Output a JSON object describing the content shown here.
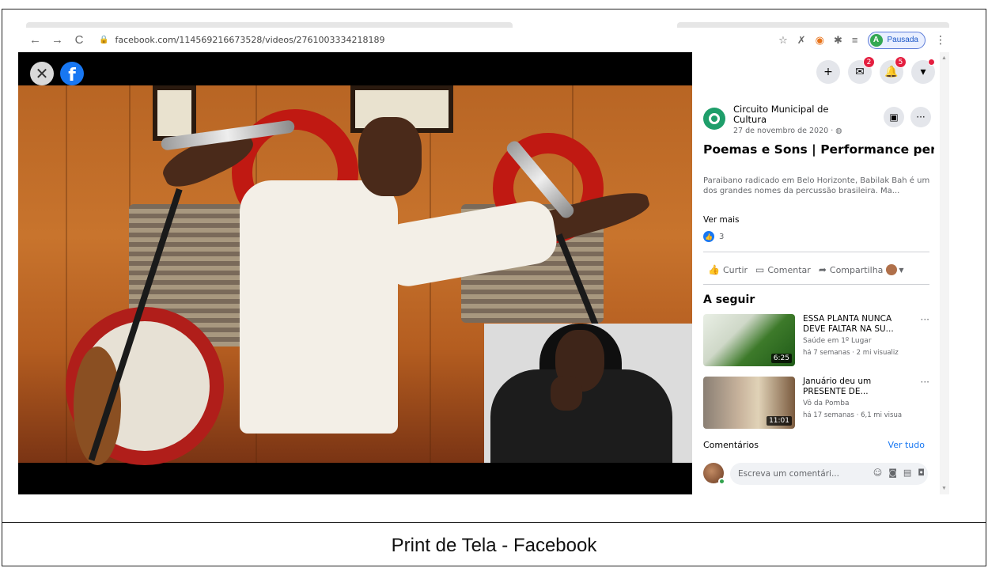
{
  "document": {
    "caption": "Print de Tela - Facebook"
  },
  "browser": {
    "url": "facebook.com/114569216673528/videos/2761003334218189",
    "profile_status": "Pausada",
    "profile_initial": "A"
  },
  "video": {
    "close_glyph": "✕",
    "fb_glyph": "f"
  },
  "topbar": {
    "messenger_badge": "2",
    "notifications_badge": "5"
  },
  "post": {
    "page_name": "Circuito Municipal de Cultura",
    "date": "27 de novembro de 2020 · ",
    "title": "Poemas e Sons | Performance percussiva de Babilak Bah (com...",
    "description": "Paraibano radicado em Belo Horizonte, Babilak Bah é um dos grandes nomes da percussão brasileira. Ma...",
    "see_more": "Ver mais",
    "reaction_count": "3",
    "actions": {
      "like": "Curtir",
      "comment": "Comentar",
      "share": "Compartilha"
    }
  },
  "up_next": {
    "heading": "A seguir",
    "items": [
      {
        "title": "ESSA PLANTA NUNCA DEVE FALTAR NA SU...",
        "channel": "Saúde em 1º Lugar",
        "meta": "há 7 semanas · 2 mi visualiz",
        "duration": "6:25"
      },
      {
        "title": "Januário deu um PRESENTE DE...",
        "channel": "Vô da Pomba",
        "meta": "há 17 semanas · 6,1 mi visua",
        "duration": "11:01"
      }
    ]
  },
  "comments": {
    "heading": "Comentários",
    "see_all": "Ver tudo",
    "placeholder": "Escreva um comentári..."
  },
  "icons": {
    "back": "back-arrow-icon",
    "forward": "forward-arrow-icon",
    "reload": "reload-icon",
    "lock": "lock-icon",
    "star": "star-icon",
    "extension": "puzzle-icon",
    "plus": "plus-icon",
    "messenger": "messenger-icon",
    "bell": "bell-icon",
    "account": "caret-down-icon"
  },
  "colors": {
    "facebook_blue": "#1877f2",
    "badge_red": "#e41e3f",
    "page_green": "#1e9e6a"
  }
}
